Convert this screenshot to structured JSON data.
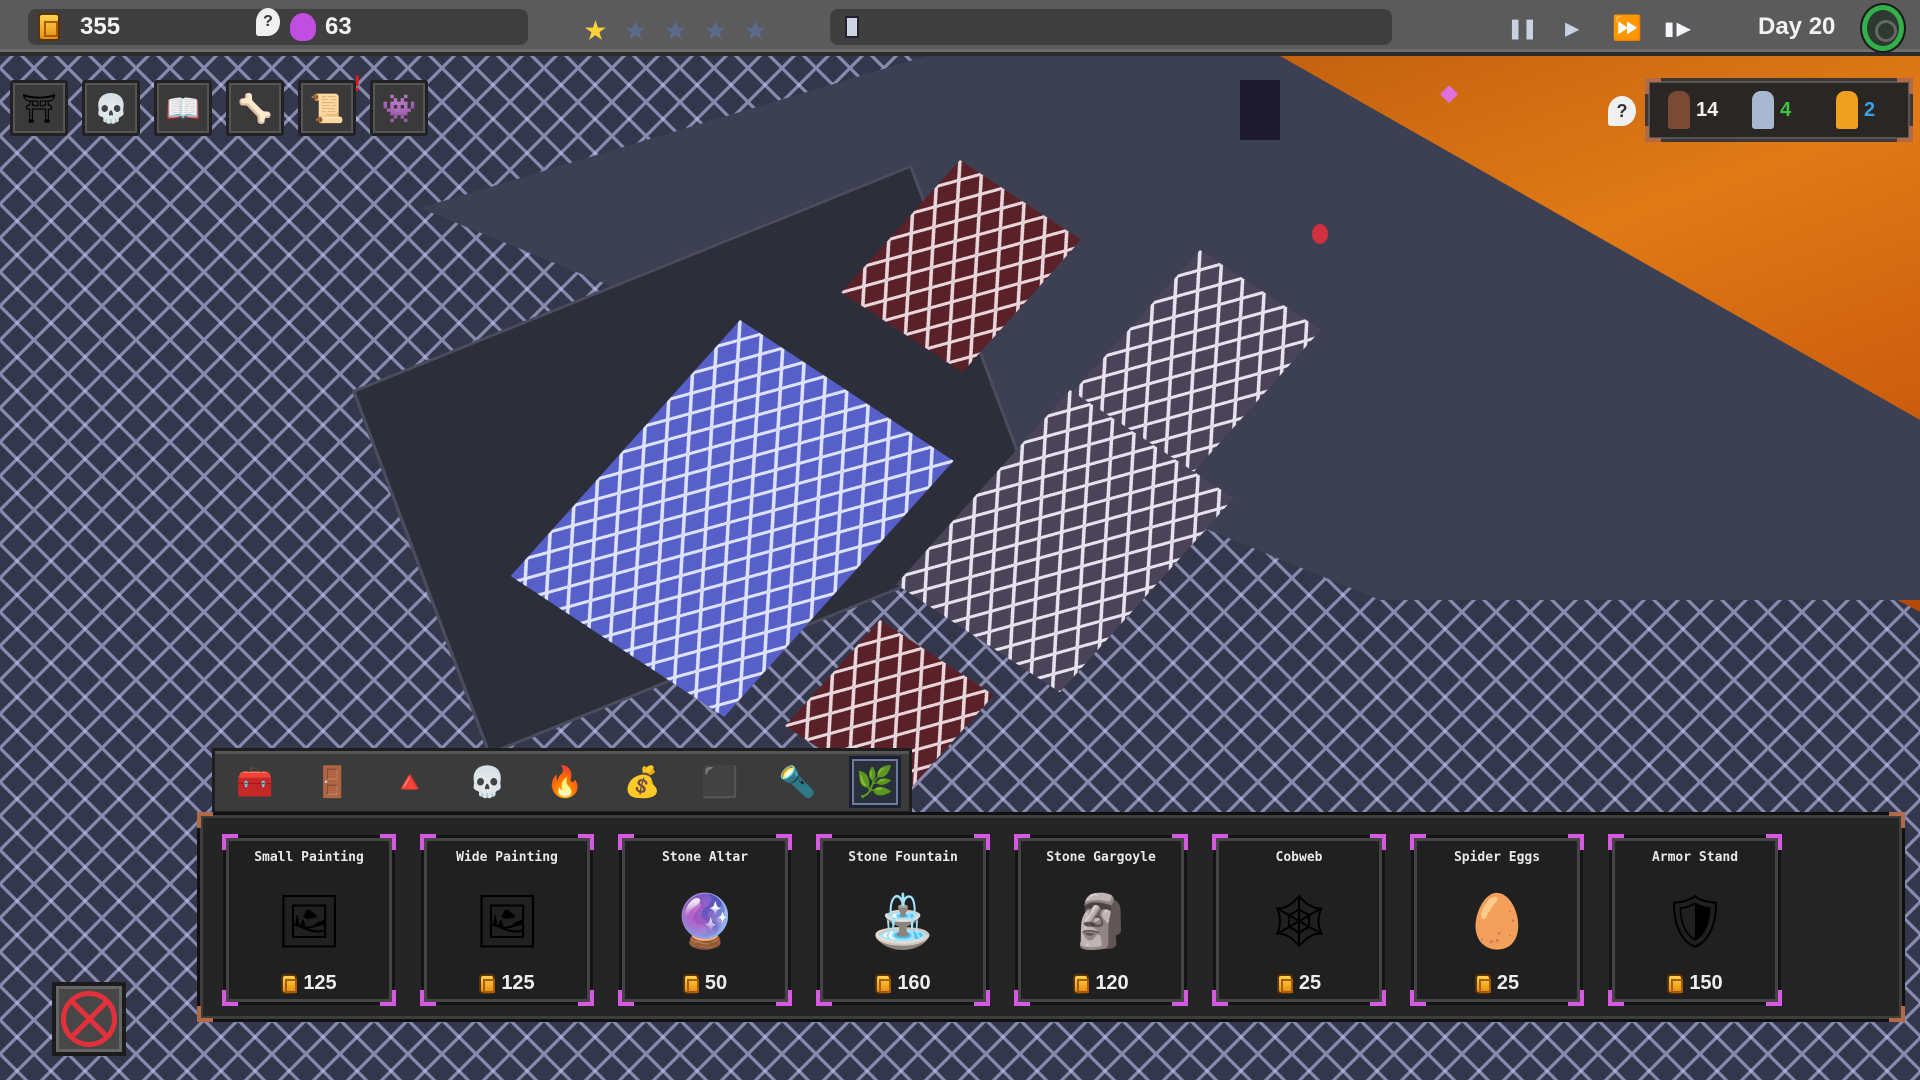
{
  "hud": {
    "gold": "355",
    "souls": "63",
    "rating": {
      "filled": 1,
      "total": 5
    },
    "day_label": "Day 20",
    "controls": [
      "pause",
      "play",
      "fast-forward",
      "skip"
    ],
    "colors": {
      "gold": "#f5b21f",
      "star_filled": "#ffd23a",
      "star_empty": "#5c6b8c",
      "accent_pink": "#d45ae0",
      "settings_green": "#34b04a"
    }
  },
  "menu_buttons": [
    {
      "id": "portal",
      "icon": "portal-icon",
      "glyph": "⛩"
    },
    {
      "id": "skull",
      "icon": "skull-icon",
      "glyph": "💀"
    },
    {
      "id": "book",
      "icon": "book-icon",
      "glyph": "📖"
    },
    {
      "id": "claws",
      "icon": "claw-icon",
      "glyph": "🦴"
    },
    {
      "id": "notice",
      "icon": "notice-board-icon",
      "glyph": "📜",
      "badge": "!"
    },
    {
      "id": "chest",
      "icon": "chest-icon",
      "glyph": "👾"
    }
  ],
  "population": {
    "hint": "?",
    "groups": [
      {
        "name": "peasants",
        "count": "14",
        "color": "#f0f0f0",
        "fig": "#7a4a34"
      },
      {
        "name": "knights",
        "count": "4",
        "color": "#3fc43f",
        "fig": "#a8b8d0"
      },
      {
        "name": "heroes",
        "count": "2",
        "color": "#3aa0e8",
        "fig": "#f0a020"
      }
    ]
  },
  "categories": [
    {
      "id": "storage",
      "icon": "chest-icon",
      "glyph": "🧰",
      "active": false
    },
    {
      "id": "doors",
      "icon": "door-icon",
      "glyph": "🚪",
      "active": false
    },
    {
      "id": "traps",
      "icon": "spikes-icon",
      "glyph": "🔺",
      "active": false
    },
    {
      "id": "monsters",
      "icon": "skull-icon",
      "glyph": "💀",
      "active": false
    },
    {
      "id": "lights",
      "icon": "fire-icon",
      "glyph": "🔥",
      "active": false
    },
    {
      "id": "loot",
      "icon": "sack-icon",
      "glyph": "💰",
      "active": false
    },
    {
      "id": "structures",
      "icon": "block-icon",
      "glyph": "⬛",
      "active": false
    },
    {
      "id": "torches",
      "icon": "torch-icon",
      "glyph": "🔦",
      "active": false
    },
    {
      "id": "decorations",
      "icon": "plant-icon",
      "glyph": "🌿",
      "active": true
    }
  ],
  "items": [
    {
      "name": "Small Painting",
      "price": "125",
      "icon": "small-painting-icon",
      "glyph": "🖼"
    },
    {
      "name": "Wide Painting",
      "price": "125",
      "icon": "wide-painting-icon",
      "glyph": "🖼"
    },
    {
      "name": "Stone Altar",
      "price": "50",
      "icon": "stone-altar-icon",
      "glyph": "🔮"
    },
    {
      "name": "Stone Fountain",
      "price": "160",
      "icon": "stone-fountain-icon",
      "glyph": "⛲"
    },
    {
      "name": "Stone Gargoyle",
      "price": "120",
      "icon": "gargoyle-icon",
      "glyph": "🗿"
    },
    {
      "name": "Cobweb",
      "price": "25",
      "icon": "cobweb-icon",
      "glyph": "🕸"
    },
    {
      "name": "Spider Eggs",
      "price": "25",
      "icon": "spider-eggs-icon",
      "glyph": "🥚"
    },
    {
      "name": "Armor Stand",
      "price": "150",
      "icon": "armor-stand-icon",
      "glyph": "🛡"
    }
  ],
  "close_button": "close"
}
